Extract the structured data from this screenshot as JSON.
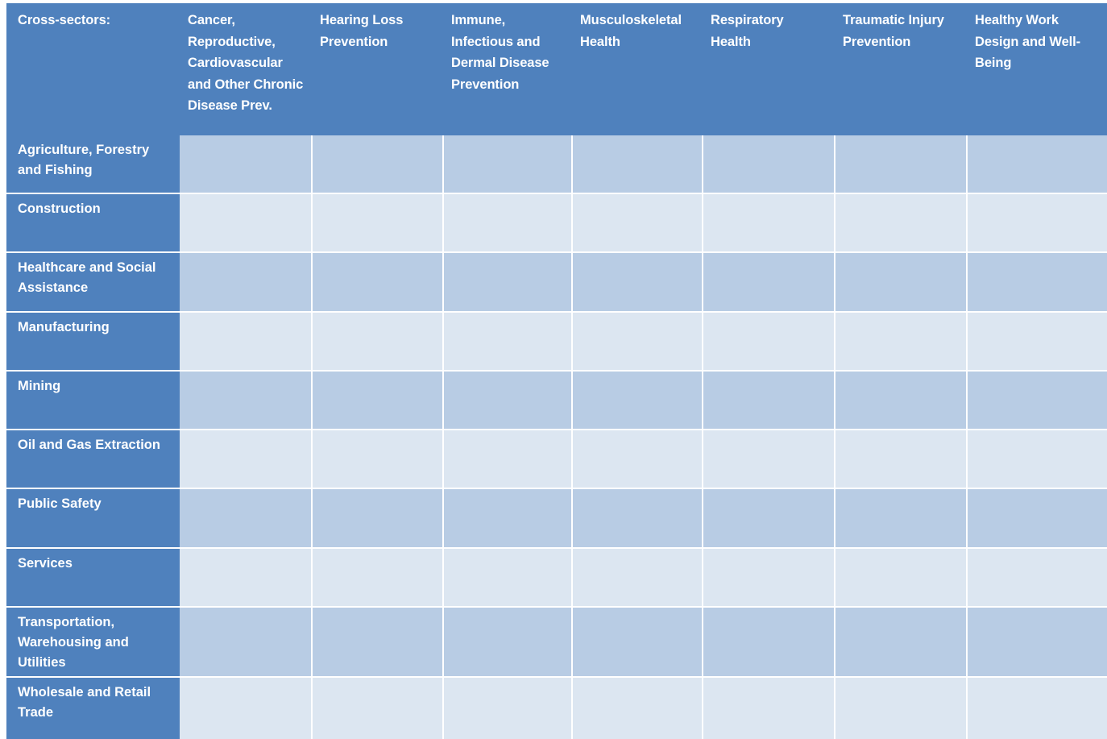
{
  "table": {
    "corner_header": "Cross-sectors:",
    "column_headers": [
      "Cancer, Reproductive, Cardiovascular and Other Chronic Disease Prev.",
      "Hearing Loss Prevention",
      "Immune, Infectious and Dermal Disease Prevention",
      "Musculoskeletal Health",
      "Respiratory Health",
      "Traumatic Injury Prevention",
      "Healthy Work Design and Well-Being"
    ],
    "row_headers": [
      "Agriculture, Forestry and Fishing",
      "Construction",
      "Healthcare and Social Assistance",
      "Manufacturing",
      "Mining",
      "Oil and Gas Extraction",
      "Public Safety",
      "Services",
      "Transportation, Warehousing and Utilities",
      "Wholesale and Retail Trade"
    ],
    "cells": [
      [
        "",
        "",
        "",
        "",
        "",
        "",
        ""
      ],
      [
        "",
        "",
        "",
        "",
        "",
        "",
        ""
      ],
      [
        "",
        "",
        "",
        "",
        "",
        "",
        ""
      ],
      [
        "",
        "",
        "",
        "",
        "",
        "",
        ""
      ],
      [
        "",
        "",
        "",
        "",
        "",
        "",
        ""
      ],
      [
        "",
        "",
        "",
        "",
        "",
        "",
        ""
      ],
      [
        "",
        "",
        "",
        "",
        "",
        "",
        ""
      ],
      [
        "",
        "",
        "",
        "",
        "",
        "",
        ""
      ],
      [
        "",
        "",
        "",
        "",
        "",
        "",
        ""
      ],
      [
        "",
        "",
        "",
        "",
        "",
        "",
        ""
      ]
    ]
  },
  "colors": {
    "header_blue": "#4f81bd",
    "band_dark": "#b8cce4",
    "band_light": "#dce6f1",
    "header_text": "#ffffff",
    "gridline": "#ffffff"
  }
}
